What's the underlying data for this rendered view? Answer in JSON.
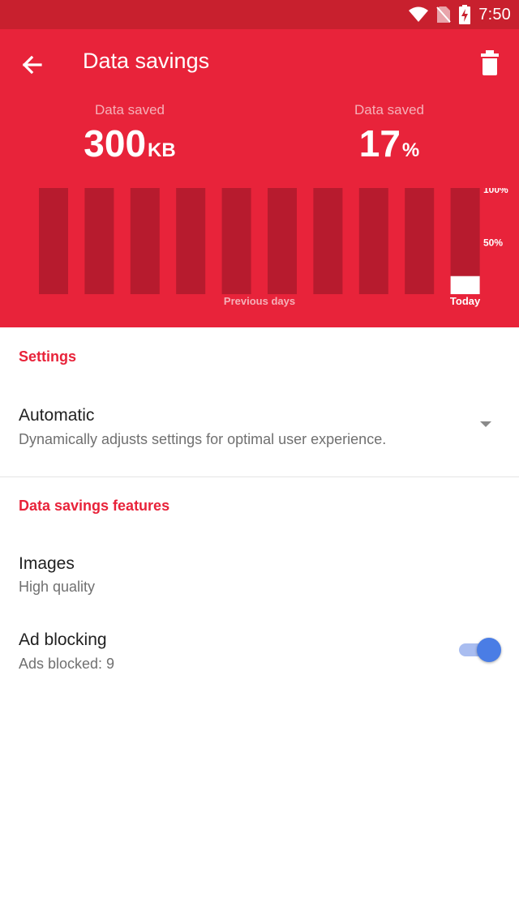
{
  "status_bar": {
    "time": "7:50",
    "icons": [
      "wifi-icon",
      "no-sim-icon",
      "battery-charging-icon"
    ]
  },
  "header": {
    "title": "Data savings",
    "back_icon": "arrow-back-icon",
    "delete_icon": "trash-icon",
    "stats": [
      {
        "label": "Data saved",
        "value": "300",
        "unit": "KB"
      },
      {
        "label": "Data saved",
        "value": "17",
        "unit": "%"
      }
    ]
  },
  "chart_data": {
    "type": "bar",
    "categories": [
      "",
      "",
      "",
      "",
      "",
      "",
      "",
      "",
      "",
      "Today"
    ],
    "values": [
      0,
      0,
      0,
      0,
      0,
      0,
      0,
      0,
      0,
      17
    ],
    "ylim": [
      0,
      100
    ],
    "y_ticks": [
      "100%",
      "50%"
    ],
    "x_labels": {
      "previous": "Previous days",
      "today": "Today"
    },
    "grid": false,
    "colors": {
      "bar_background": "#b71b2e",
      "bar_fill": "#ffffff"
    }
  },
  "settings": {
    "header": "Settings",
    "mode": {
      "title": "Automatic",
      "subtitle": "Dynamically adjusts settings for optimal user experience."
    }
  },
  "features": {
    "header": "Data savings features",
    "images": {
      "title": "Images",
      "subtitle": "High quality"
    },
    "ad_blocking": {
      "title": "Ad blocking",
      "subtitle": "Ads blocked: 9",
      "enabled": true
    }
  },
  "colors": {
    "accent": "#e8233a",
    "status_bar": "#c8202e",
    "toggle_on": "#4a7de5"
  }
}
